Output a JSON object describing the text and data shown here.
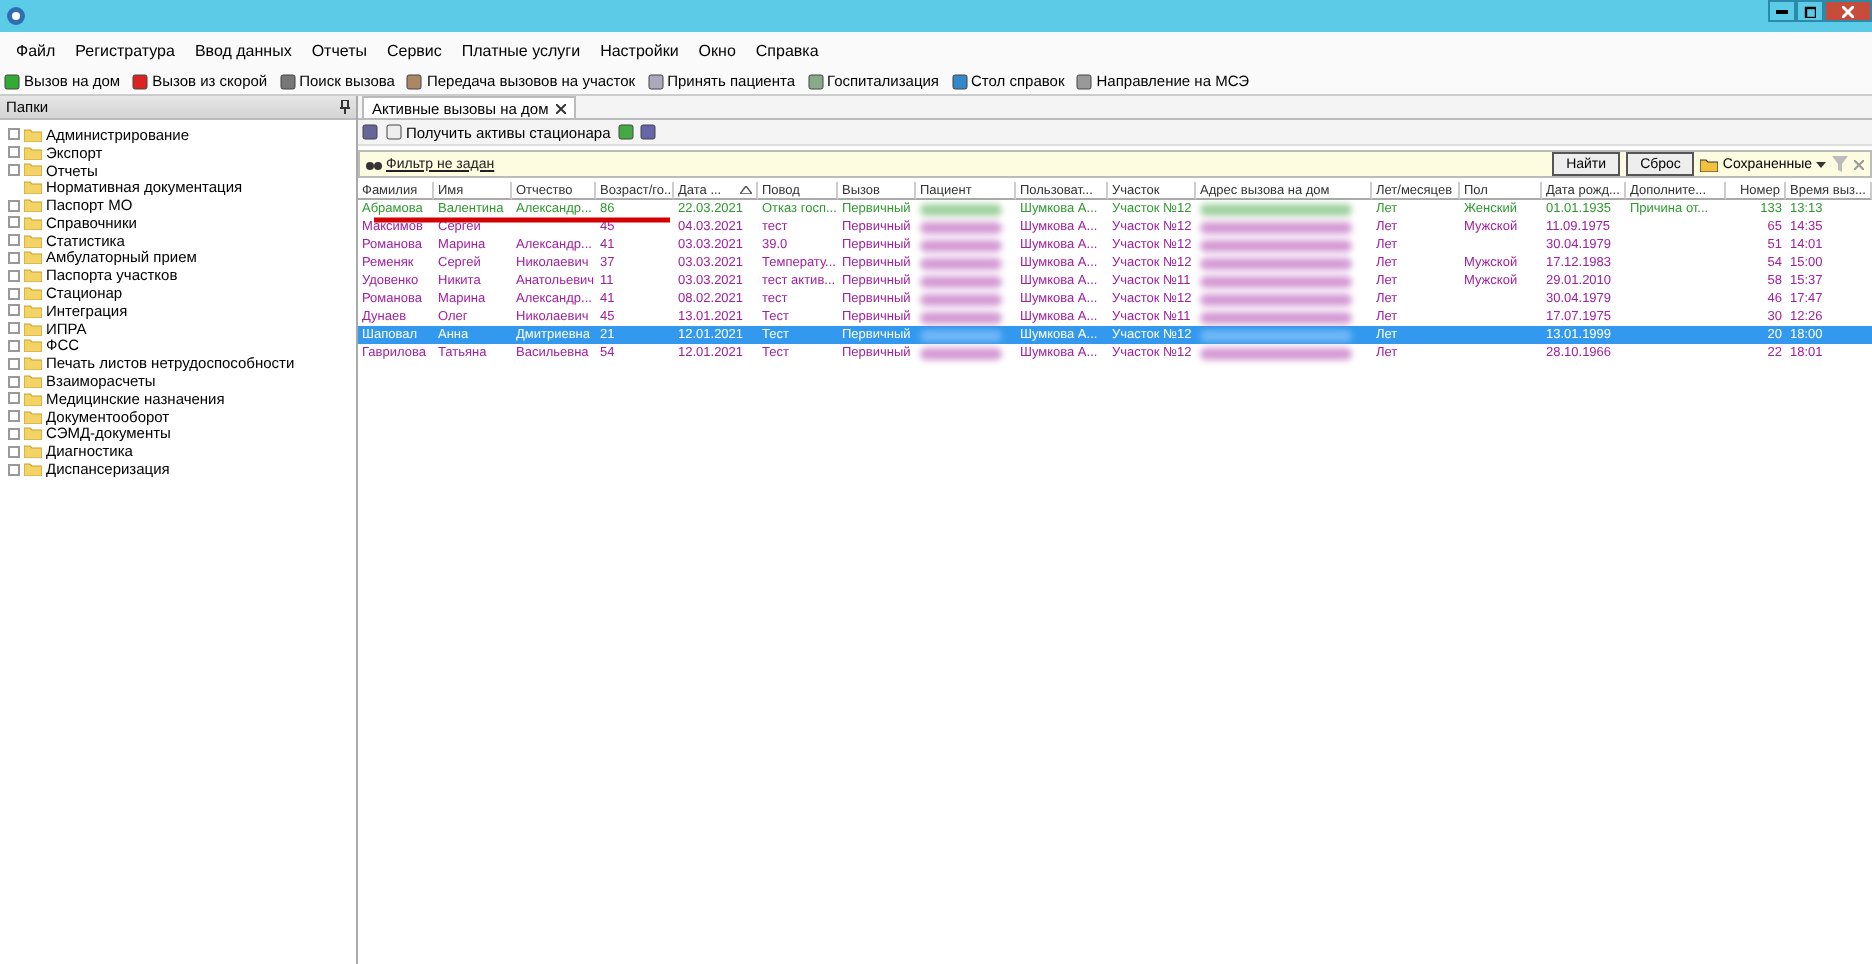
{
  "menu": [
    "Файл",
    "Регистратура",
    "Ввод данных",
    "Отчеты",
    "Сервис",
    "Платные услуги",
    "Настройки",
    "Окно",
    "Справка"
  ],
  "toolbar": [
    "Вызов на дом",
    "Вызов из скорой",
    "Поиск вызова",
    "Передача вызовов на участок",
    "Принять пациента",
    "Госпитализация",
    "Стол справок",
    "Направление на МСЭ"
  ],
  "sidebar": {
    "title": "Папки",
    "items": [
      {
        "label": "Администрирование",
        "has_children": true
      },
      {
        "label": "Экспорт",
        "has_children": true
      },
      {
        "label": "Отчеты",
        "has_children": true
      },
      {
        "label": "Нормативная документация",
        "has_children": false
      },
      {
        "label": "Паспорт МО",
        "has_children": true
      },
      {
        "label": "Справочники",
        "has_children": true
      },
      {
        "label": "Статистика",
        "has_children": true
      },
      {
        "label": "Амбулаторный прием",
        "has_children": true
      },
      {
        "label": "Паспорта участков",
        "has_children": true
      },
      {
        "label": "Стационар",
        "has_children": true
      },
      {
        "label": "Интеграция",
        "has_children": true
      },
      {
        "label": "ИПРА",
        "has_children": true
      },
      {
        "label": "ФСС",
        "has_children": true
      },
      {
        "label": "Печать листов нетрудоспособности",
        "has_children": true
      },
      {
        "label": "Взаиморасчеты",
        "has_children": true
      },
      {
        "label": "Медицинские назначения",
        "has_children": true
      },
      {
        "label": "Документооборот",
        "has_children": true
      },
      {
        "label": "СЭМД-документы",
        "has_children": true
      },
      {
        "label": "Диагностика",
        "has_children": true
      },
      {
        "label": "Диспансеризация",
        "has_children": true
      }
    ]
  },
  "tabs": [
    {
      "label": "Активные вызовы на дом",
      "selected": true
    }
  ],
  "panel_toolbar": {
    "button": "Получить активы стационара"
  },
  "filter": {
    "link": "Фильтр не задан",
    "find": "Найти",
    "reset": "Сброс",
    "saved": "Сохраненные"
  },
  "table": {
    "columns": [
      {
        "label": "Фамилия",
        "kind": "text"
      },
      {
        "label": "Имя",
        "kind": "text"
      },
      {
        "label": "Отчество",
        "kind": "text"
      },
      {
        "label": "Возраст/го...",
        "kind": "text"
      },
      {
        "label": "Дата ...",
        "kind": "sorted"
      },
      {
        "label": "Повод",
        "kind": "text"
      },
      {
        "label": "Вызов",
        "kind": "text"
      },
      {
        "label": "Пациент",
        "kind": "hidden"
      },
      {
        "label": "Пользоват...",
        "kind": "text"
      },
      {
        "label": "Участок",
        "kind": "text"
      },
      {
        "label": "Адрес вызова на дом",
        "kind": "hidden"
      },
      {
        "label": "Лет/месяцев",
        "kind": "text"
      },
      {
        "label": "Пол",
        "kind": "text"
      },
      {
        "label": "Дата рожд...",
        "kind": "text"
      },
      {
        "label": "Дополните...",
        "kind": "text"
      },
      {
        "label": "Номер",
        "kind": "number"
      },
      {
        "label": "Время выз...",
        "kind": "text"
      }
    ],
    "rows": [
      {
        "color": "#2e9a2e",
        "selected": false,
        "cells": [
          "Абрамова",
          "Валентина",
          "Александр...",
          "86",
          "22.03.2021",
          "Отказ госп...",
          "Первичный",
          "",
          "Шумкова А...",
          "Участок №12",
          "",
          "Лет",
          "Женский",
          "01.01.1935",
          "Причина от...",
          "133",
          "13:13"
        ]
      },
      {
        "color": "#a020a0",
        "selected": false,
        "cells": [
          "Максимов",
          "Сергей",
          "",
          "45",
          "04.03.2021",
          "тест",
          "Первичный",
          "",
          "Шумкова А...",
          "Участок №12",
          "",
          "Лет",
          "Мужской",
          "11.09.1975",
          "",
          "65",
          "14:35"
        ]
      },
      {
        "color": "#a020a0",
        "selected": false,
        "cells": [
          "Романова",
          "Марина",
          "Александр...",
          "41",
          "03.03.2021",
          "39.0",
          "Первичный",
          "",
          "Шумкова А...",
          "Участок №12",
          "",
          "Лет",
          "",
          "30.04.1979",
          "",
          "51",
          "14:01"
        ]
      },
      {
        "color": "#a020a0",
        "selected": false,
        "cells": [
          "Ременяк",
          "Сергей",
          "Николаевич",
          "37",
          "03.03.2021",
          "Температу...",
          "Первичный",
          "",
          "Шумкова А...",
          "Участок №12",
          "",
          "Лет",
          "Мужской",
          "17.12.1983",
          "",
          "54",
          "15:00"
        ]
      },
      {
        "color": "#a020a0",
        "selected": false,
        "cells": [
          "Удовенко",
          "Никита",
          "Анатольевич",
          "11",
          "03.03.2021",
          "тест актив...",
          "Первичный",
          "",
          "Шумкова А...",
          "Участок №11",
          "",
          "Лет",
          "Мужской",
          "29.01.2010",
          "",
          "58",
          "15:37"
        ]
      },
      {
        "color": "#a020a0",
        "selected": false,
        "cells": [
          "Романова",
          "Марина",
          "Александр...",
          "41",
          "08.02.2021",
          "тест",
          "Первичный",
          "",
          "Шумкова А...",
          "Участок №12",
          "",
          "Лет",
          "",
          "30.04.1979",
          "",
          "46",
          "17:47"
        ]
      },
      {
        "color": "#a020a0",
        "selected": false,
        "cells": [
          "Дунаев",
          "Олег",
          "Николаевич",
          "45",
          "13.01.2021",
          "Тест",
          "Первичный",
          "",
          "Шумкова А...",
          "Участок №11",
          "",
          "Лет",
          "",
          "17.07.1975",
          "",
          "30",
          "12:26"
        ]
      },
      {
        "selected": true,
        "cells": [
          "Шаповал",
          "Анна",
          "Дмитриевна",
          "21",
          "12.01.2021",
          "Тест",
          "Первичный",
          "",
          "Шумкова А...",
          "Участок №12",
          "",
          "Лет",
          "",
          "13.01.1999",
          "",
          "20",
          "18:00"
        ]
      },
      {
        "color": "#a020a0",
        "selected": false,
        "cells": [
          "Гаврилова",
          "Татьяна",
          "Васильевна",
          "54",
          "12.01.2021",
          "Тест",
          "Первичный",
          "",
          "Шумкова А...",
          "Участок №12",
          "",
          "Лет",
          "",
          "28.10.1966",
          "",
          "22",
          "18:01"
        ]
      }
    ]
  }
}
